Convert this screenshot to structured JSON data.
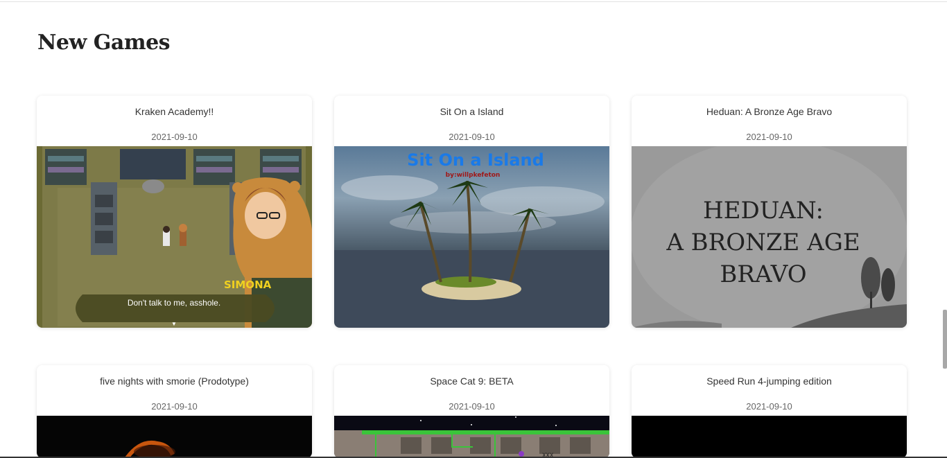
{
  "section": {
    "title": "New Games"
  },
  "games": [
    {
      "title": "Kraken Academy!!",
      "date": "2021-09-10",
      "thumb": {
        "speaker": "SIMONA",
        "dialog": "Don't talk to me, asshole."
      }
    },
    {
      "title": "Sit On a Island",
      "date": "2021-09-10",
      "thumb": {
        "logo": "Sit On a Island",
        "byline": "by:willpkefeton"
      }
    },
    {
      "title": "Heduan: A Bronze Age Bravo",
      "date": "2021-09-10",
      "thumb": {
        "line1": "HEDUAN:",
        "line2": "A BRONZE AGE",
        "line3": "BRAVO"
      }
    },
    {
      "title": "five nights with smorie (Prodotype)",
      "date": "2021-09-10"
    },
    {
      "title": "Space Cat 9: BETA",
      "date": "2021-09-10"
    },
    {
      "title": "Speed Run 4-jumping edition",
      "date": "2021-09-10"
    }
  ]
}
